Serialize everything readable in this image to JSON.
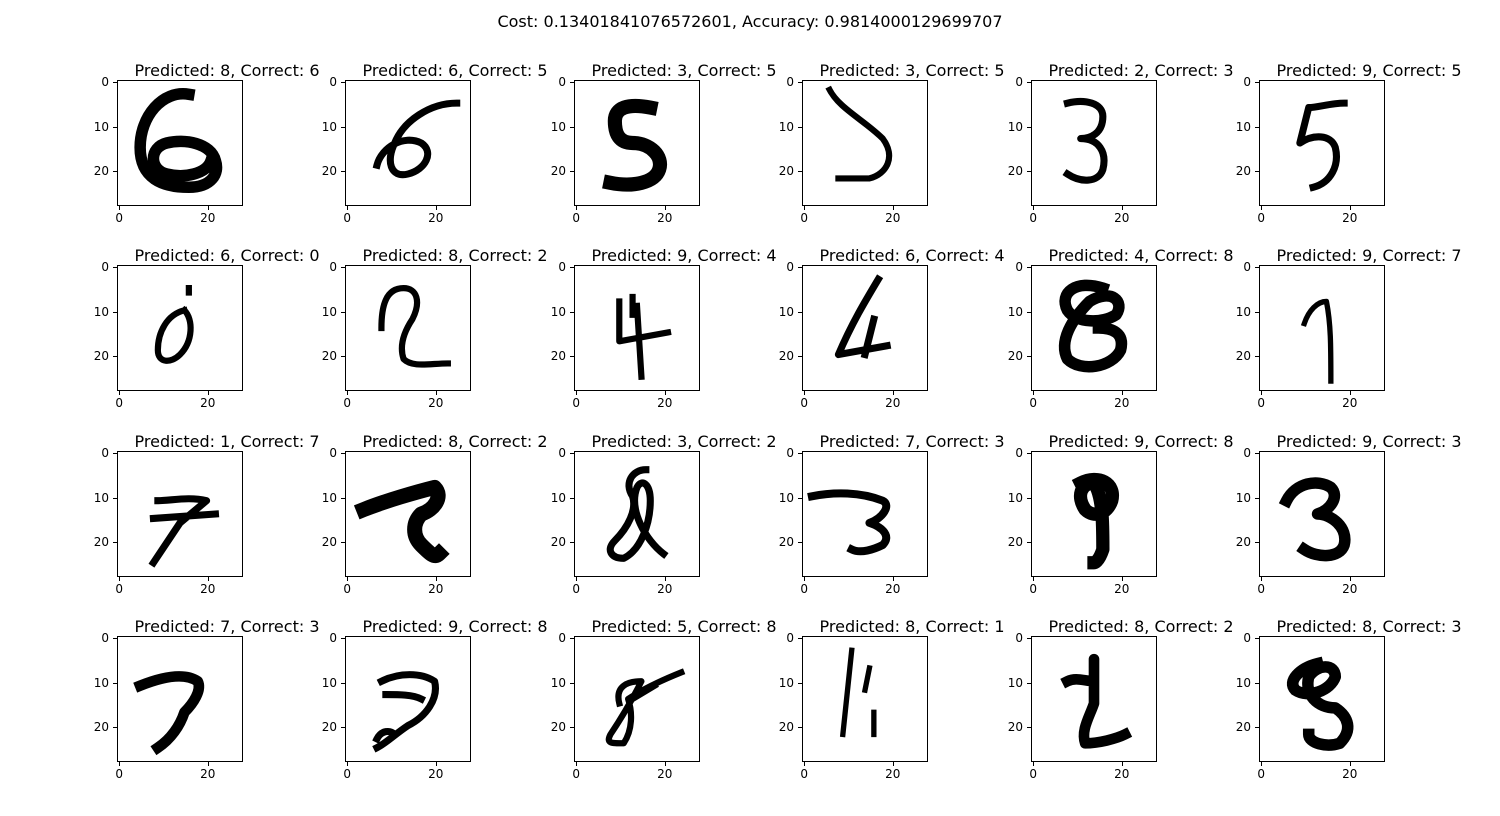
{
  "figure": {
    "suptitle": "Cost: 0.13401841076572601, Accuracy: 0.9814000129699707"
  },
  "chart_data": {
    "type": "image_grid",
    "rows": 4,
    "cols": 6,
    "image_size": [
      28,
      28
    ],
    "colormap": "gray_r",
    "xticks": [
      "0",
      "20"
    ],
    "yticks": [
      "0",
      "10",
      "20"
    ],
    "panels": [
      {
        "title": "Predicted: 8, Correct: 6",
        "predicted": 8,
        "correct": 6
      },
      {
        "title": "Predicted: 6, Correct: 5",
        "predicted": 6,
        "correct": 5
      },
      {
        "title": "Predicted: 3, Correct: 5",
        "predicted": 3,
        "correct": 5
      },
      {
        "title": "Predicted: 3, Correct: 5",
        "predicted": 3,
        "correct": 5
      },
      {
        "title": "Predicted: 2, Correct: 3",
        "predicted": 2,
        "correct": 3
      },
      {
        "title": "Predicted: 9, Correct: 5",
        "predicted": 9,
        "correct": 5
      },
      {
        "title": "Predicted: 6, Correct: 0",
        "predicted": 6,
        "correct": 0
      },
      {
        "title": "Predicted: 8, Correct: 2",
        "predicted": 8,
        "correct": 2
      },
      {
        "title": "Predicted: 9, Correct: 4",
        "predicted": 9,
        "correct": 4
      },
      {
        "title": "Predicted: 6, Correct: 4",
        "predicted": 6,
        "correct": 4
      },
      {
        "title": "Predicted: 4, Correct: 8",
        "predicted": 4,
        "correct": 8
      },
      {
        "title": "Predicted: 9, Correct: 7",
        "predicted": 9,
        "correct": 7
      },
      {
        "title": "Predicted: 1, Correct: 7",
        "predicted": 1,
        "correct": 7
      },
      {
        "title": "Predicted: 8, Correct: 2",
        "predicted": 8,
        "correct": 2
      },
      {
        "title": "Predicted: 3, Correct: 2",
        "predicted": 3,
        "correct": 2
      },
      {
        "title": "Predicted: 7, Correct: 3",
        "predicted": 7,
        "correct": 3
      },
      {
        "title": "Predicted: 9, Correct: 8",
        "predicted": 9,
        "correct": 8
      },
      {
        "title": "Predicted: 9, Correct: 3",
        "predicted": 9,
        "correct": 3
      },
      {
        "title": "Predicted: 7, Correct: 3",
        "predicted": 7,
        "correct": 3
      },
      {
        "title": "Predicted: 9, Correct: 8",
        "predicted": 9,
        "correct": 8
      },
      {
        "title": "Predicted: 5, Correct: 8",
        "predicted": 5,
        "correct": 8
      },
      {
        "title": "Predicted: 8, Correct: 1",
        "predicted": 8,
        "correct": 1
      },
      {
        "title": "Predicted: 8, Correct: 2",
        "predicted": 8,
        "correct": 2
      },
      {
        "title": "Predicted: 8, Correct: 3",
        "predicted": 8,
        "correct": 3
      }
    ]
  }
}
